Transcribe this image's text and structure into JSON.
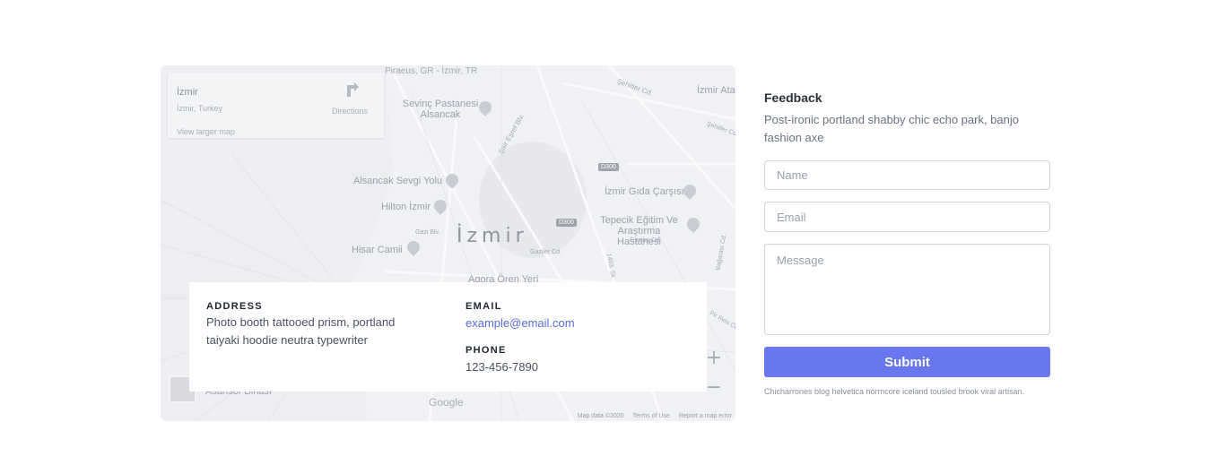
{
  "map": {
    "place": {
      "name": "İzmir",
      "address": "İzmir, Turkey",
      "larger_map_link": "View larger map",
      "directions_label": "Directions"
    },
    "city_label": "İzmir",
    "labels": [
      "Piraeus, GR - İzmir, TR",
      "Şehitler Cd.",
      "İzmir Ata",
      "Sevinç Pastanesi Alsancak",
      "Şair Eşref Blv.",
      "Şehitler Cd.",
      "Alsancak Sevgi Yolu",
      "İzmir Gıda Çarşısı",
      "Hilton İzmir",
      "Tepecik Eğitim Ve Araştırma Hastanesi",
      "Gazi Blv.",
      "Gaziler Cd.",
      "Hisar Camii",
      "Gaziler Cd.",
      "Agora Ören Yeri",
      "Asansör Binası",
      "1453. Sk",
      "Bağarası Cd.",
      "Pir Reis Cd."
    ],
    "route_shields": [
      "D300",
      "D300"
    ],
    "zoom_in": "+",
    "zoom_out": "−",
    "logo": "Google",
    "footer": {
      "map_data": "Map data ©2020",
      "terms": "Terms of Use",
      "report": "Report a map error"
    }
  },
  "info": {
    "address_title": "ADDRESS",
    "address_text": "Photo booth tattooed prism, portland taiyaki hoodie neutra typewriter",
    "email_title": "EMAIL",
    "email_value": "example@email.com",
    "phone_title": "PHONE",
    "phone_value": "123-456-7890"
  },
  "feedback": {
    "title": "Feedback",
    "description": "Post-ironic portland shabby chic echo park, banjo fashion axe",
    "name_placeholder": "Name",
    "email_placeholder": "Email",
    "message_placeholder": "Message",
    "submit_label": "Submit",
    "footnote": "Chicharrones blog helvetica normcore iceland tousled brook viral artisan."
  },
  "colors": {
    "accent": "#6777ee",
    "link": "#5b6be0",
    "map_bg": "#eceef2"
  }
}
